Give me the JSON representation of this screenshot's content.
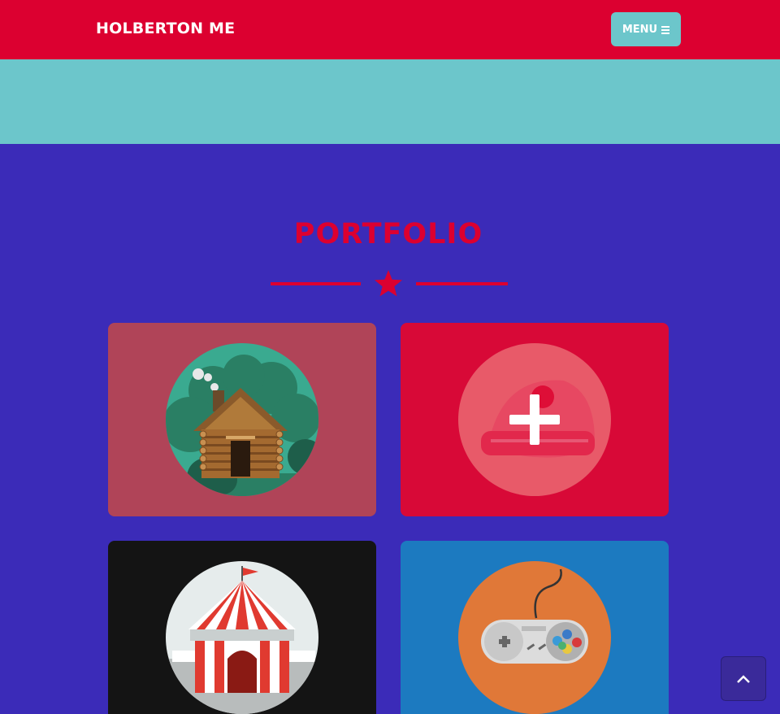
{
  "nav": {
    "brand": "HOLBERTON ME",
    "menu_label": "MENU",
    "menu_icon": "bars-icon"
  },
  "portfolio": {
    "title": "PORTFOLIO",
    "divider_icon": "star-icon",
    "items": [
      {
        "name": "cabin",
        "icon": "log-cabin-icon"
      },
      {
        "name": "cake",
        "icon": "cake-icon"
      },
      {
        "name": "circus",
        "icon": "circus-tent-icon"
      },
      {
        "name": "game",
        "icon": "game-controller-icon"
      }
    ]
  },
  "colors": {
    "primary": "#dc0030",
    "teal": "#6cc6cb",
    "background": "#3b2bb8"
  }
}
